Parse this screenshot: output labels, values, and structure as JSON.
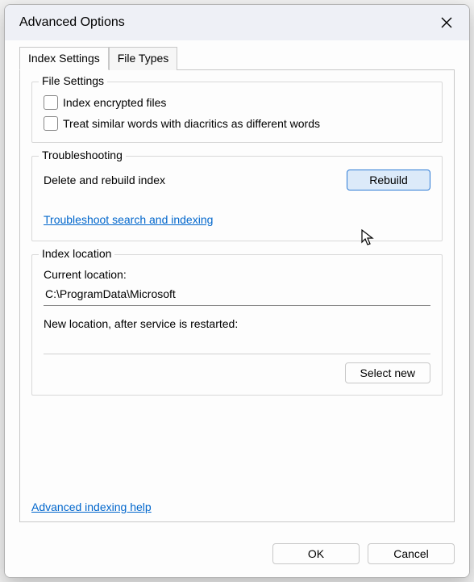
{
  "title": "Advanced Options",
  "tabs": {
    "index_settings": "Index Settings",
    "file_types": "File Types"
  },
  "file_settings": {
    "legend": "File Settings",
    "encrypt": "Index encrypted files",
    "diacritics": "Treat similar words with diacritics as different words"
  },
  "troubleshooting": {
    "legend": "Troubleshooting",
    "rebuild_label": "Delete and rebuild index",
    "rebuild_button": "Rebuild",
    "link": "Troubleshoot search and indexing"
  },
  "index_location": {
    "legend": "Index location",
    "current_label": "Current location:",
    "current_value": "C:\\ProgramData\\Microsoft",
    "new_label": "New location, after service is restarted:",
    "new_value": "",
    "select_new": "Select new"
  },
  "help_link": "Advanced indexing help",
  "buttons": {
    "ok": "OK",
    "cancel": "Cancel"
  }
}
